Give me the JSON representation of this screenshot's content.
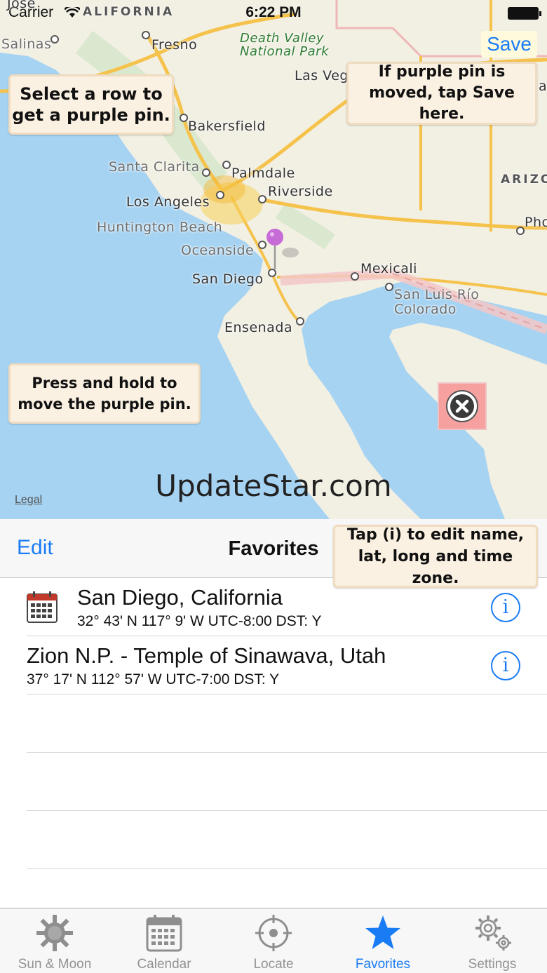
{
  "status_bar": {
    "carrier": "Carrier",
    "time": "6:22 PM"
  },
  "map": {
    "labels": {
      "jose": "Jose",
      "california": "ALIFORNIA",
      "salinas": "Salinas",
      "fresno": "Fresno",
      "death_valley": "Death Valley\nNational Park",
      "las_vegas": "Las Veg",
      "bakersfield": "Bakersfield",
      "santa_clarita": "Santa Clarita",
      "palmdale": "Palmdale",
      "riverside": "Riverside",
      "los_angeles": "Los Angeles",
      "huntington": "Huntington Beach",
      "oceanside": "Oceanside",
      "san_diego": "San Diego",
      "mexicali": "Mexicali",
      "san_luis": "San Luis Río\nColorado",
      "ensenada": "Ensenada",
      "arizona": "ARIZO",
      "phoenix": "Pho",
      "edge_a": "a"
    },
    "save_label": "Save",
    "notes": {
      "select_row": "Select a row to\nget a purple pin.",
      "moved": "If purple pin is\nmoved, tap Save here.",
      "press_hold": "Press and hold to\nmove the purple pin.",
      "tap_info": "Tap (i) to edit name,\nlat, long and time zone."
    },
    "watermark": "UpdateStar.com",
    "legal": "Legal",
    "pin_color": "#c76bd6"
  },
  "navbar": {
    "edit": "Edit",
    "title": "Favorites"
  },
  "favorites": [
    {
      "title": "San Diego, California",
      "subtitle": "32° 43' N  117° 9' W  UTC-8:00  DST: Y",
      "has_calendar_icon": true
    },
    {
      "title": "Zion N.P. - Temple of Sinawava, Utah",
      "subtitle": "37° 17' N  112° 57' W  UTC-7:00  DST: Y",
      "has_calendar_icon": false
    }
  ],
  "tabs": [
    {
      "label": "Sun & Moon",
      "icon": "sun-icon",
      "active": false
    },
    {
      "label": "Calendar",
      "icon": "calendar-icon",
      "active": false
    },
    {
      "label": "Locate",
      "icon": "crosshair-icon",
      "active": false
    },
    {
      "label": "Favorites",
      "icon": "star-icon",
      "active": true
    },
    {
      "label": "Settings",
      "icon": "gear-icon",
      "active": false
    }
  ],
  "colors": {
    "accent": "#1a7cf5",
    "water": "#a6d3f2",
    "land": "#f2efe3",
    "road": "#f5c24b"
  }
}
